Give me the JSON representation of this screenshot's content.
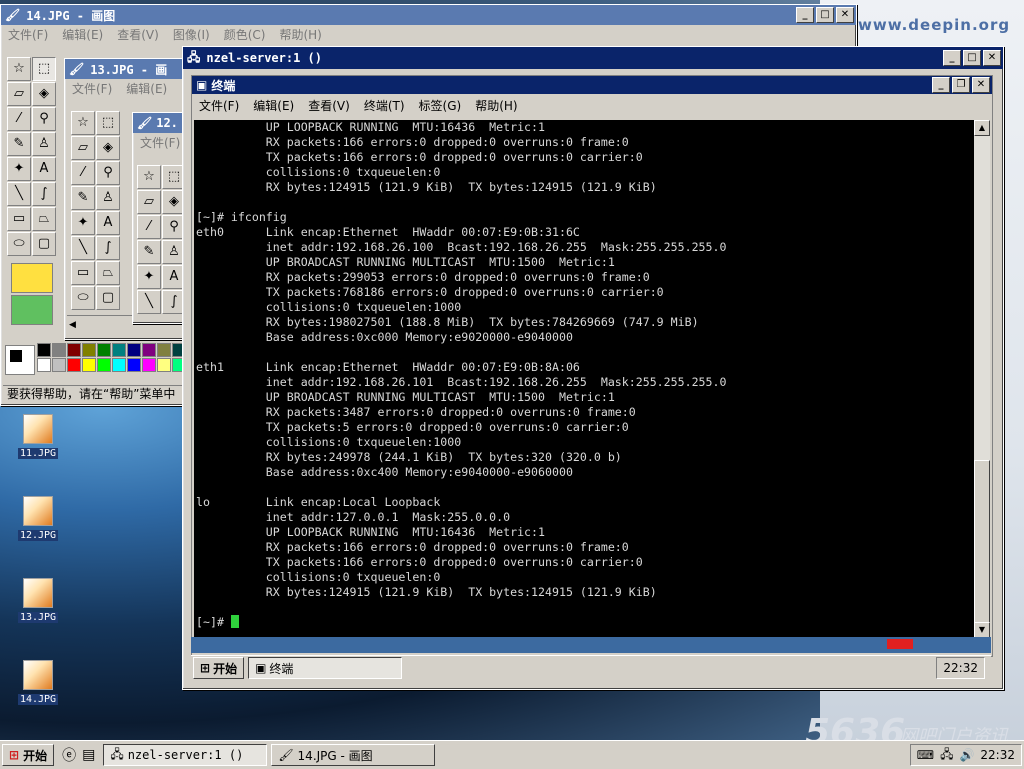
{
  "desktop": {
    "watermark_site": "www.deepin.org",
    "watermark_5636": "5636",
    "watermark_cn": "网吧门户资讯",
    "icons": [
      {
        "label": "11.JPG"
      },
      {
        "label": "12.JPG"
      },
      {
        "label": "13.JPG"
      },
      {
        "label": "14.JPG"
      }
    ]
  },
  "paint14": {
    "title": "14.JPG - 画图",
    "menu": [
      "文件(F)",
      "编辑(E)",
      "查看(V)",
      "图像(I)",
      "颜色(C)",
      "帮助(H)"
    ],
    "status": "要获得帮助，请在“帮助”菜单中"
  },
  "paint13": {
    "title": "13.JPG - 画",
    "menu": [
      "文件(F)",
      "编辑(E)"
    ]
  },
  "paint12": {
    "title": "12.",
    "menu": [
      "文件(F)"
    ]
  },
  "vnc": {
    "title": "nzel-server:1 ()"
  },
  "terminal": {
    "title": "终端",
    "menu": [
      "文件(F)",
      "编辑(E)",
      "查看(V)",
      "终端(T)",
      "标签(G)",
      "帮助(H)"
    ],
    "lines": [
      "          UP LOOPBACK RUNNING  MTU:16436  Metric:1",
      "          RX packets:166 errors:0 dropped:0 overruns:0 frame:0",
      "          TX packets:166 errors:0 dropped:0 overruns:0 carrier:0",
      "          collisions:0 txqueuelen:0",
      "          RX bytes:124915 (121.9 KiB)  TX bytes:124915 (121.9 KiB)",
      "",
      "[~]# ifconfig",
      "eth0      Link encap:Ethernet  HWaddr 00:07:E9:0B:31:6C",
      "          inet addr:192.168.26.100  Bcast:192.168.26.255  Mask:255.255.255.0",
      "          UP BROADCAST RUNNING MULTICAST  MTU:1500  Metric:1",
      "          RX packets:299053 errors:0 dropped:0 overruns:0 frame:0",
      "          TX packets:768186 errors:0 dropped:0 overruns:0 carrier:0",
      "          collisions:0 txqueuelen:1000",
      "          RX bytes:198027501 (188.8 MiB)  TX bytes:784269669 (747.9 MiB)",
      "          Base address:0xc000 Memory:e9020000-e9040000",
      "",
      "eth1      Link encap:Ethernet  HWaddr 00:07:E9:0B:8A:06",
      "          inet addr:192.168.26.101  Bcast:192.168.26.255  Mask:255.255.255.0",
      "          UP BROADCAST RUNNING MULTICAST  MTU:1500  Metric:1",
      "          RX packets:3487 errors:0 dropped:0 overruns:0 frame:0",
      "          TX packets:5 errors:0 dropped:0 overruns:0 carrier:0",
      "          collisions:0 txqueuelen:1000",
      "          RX bytes:249978 (244.1 KiB)  TX bytes:320 (320.0 b)",
      "          Base address:0xc400 Memory:e9040000-e9060000",
      "",
      "lo        Link encap:Local Loopback",
      "          inet addr:127.0.0.1  Mask:255.0.0.0",
      "          UP LOOPBACK RUNNING  MTU:16436  Metric:1",
      "          RX packets:166 errors:0 dropped:0 overruns:0 frame:0",
      "          TX packets:166 errors:0 dropped:0 overruns:0 carrier:0",
      "          collisions:0 txqueuelen:0",
      "          RX bytes:124915 (121.9 KiB)  TX bytes:124915 (121.9 KiB)",
      ""
    ],
    "prompt": "[~]# ",
    "cursor_color": "#2fd13c"
  },
  "inner_taskbar": {
    "start_label": "开始",
    "task_label": "终端",
    "clock": "22:32"
  },
  "taskbar": {
    "start_label": "开始",
    "tasks": [
      "nzel-server:1 ()",
      "14.JPG - 画图"
    ],
    "clock": "22:32"
  },
  "palette": [
    "#000000",
    "#808080",
    "#800000",
    "#808000",
    "#008000",
    "#008080",
    "#000080",
    "#800080",
    "#808040",
    "#004040",
    "#ffffff",
    "#c0c0c0",
    "#ff0000",
    "#ffff00",
    "#00ff00",
    "#00ffff",
    "#0000ff",
    "#ff00ff",
    "#ffff80",
    "#00ff80"
  ]
}
